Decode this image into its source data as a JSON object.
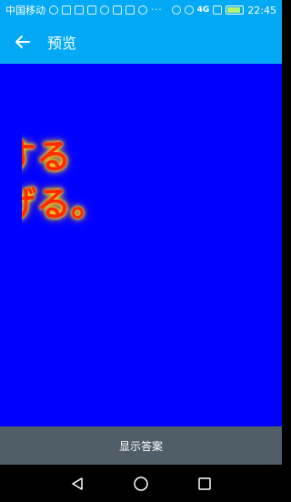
{
  "status_bar": {
    "carrier": "中国移动",
    "network": "4G",
    "time": "22:45"
  },
  "app_bar": {
    "title": "预览"
  },
  "slide": {
    "lines": [
      "する",
      "げる。",
      "。"
    ],
    "background_color": "#0000ff",
    "text_color": "#ff2a00",
    "glow_color": "#ffe100"
  },
  "answer_bar": {
    "label": "显示答案"
  },
  "nav_bar": {
    "icons": [
      "back-triangle-icon",
      "home-circle-icon",
      "recents-square-icon"
    ]
  },
  "colors": {
    "primary": "#03a9f4",
    "bottom_bar": "#4f5e67"
  }
}
